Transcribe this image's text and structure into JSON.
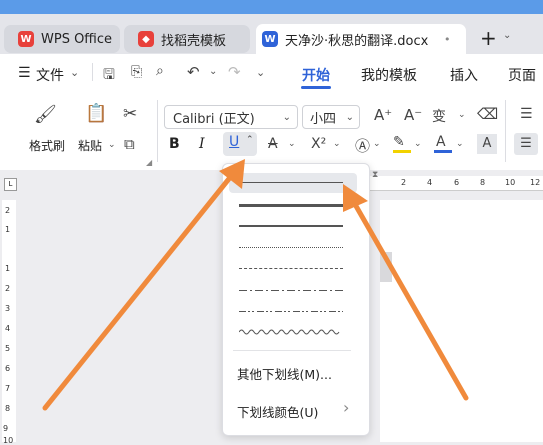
{
  "tabs": {
    "wps": {
      "label": "WPS Office",
      "icon": "wps-logo-icon",
      "color": "#e8413b"
    },
    "daoke": {
      "label": "找稻壳模板",
      "icon": "daoke-icon",
      "color": "#e8413b"
    },
    "doc": {
      "label": "天净沙·秋思的翻译.docx",
      "icon": "word-doc-icon",
      "color": "#2f63d8"
    },
    "new_tab": "+",
    "dot": "•"
  },
  "menu": {
    "file": "文件",
    "items": [
      "开始",
      "我的模板",
      "插入",
      "页面"
    ],
    "active_color": "#2f63d8"
  },
  "ribbon": {
    "format_painter": "格式刷",
    "paste": "粘贴",
    "font": "Calibri (正文)",
    "size": "小四",
    "bold": "B",
    "italic": "I",
    "underline": "U",
    "superscript": "X²",
    "pinyin": "A",
    "char_border": "A"
  },
  "ruler": {
    "h": [
      "2",
      "4",
      "6",
      "8",
      "10",
      "12"
    ],
    "v": [
      "2",
      "1",
      "1",
      "2",
      "3",
      "4",
      "5",
      "6",
      "7",
      "8",
      "9",
      "10"
    ]
  },
  "dropdown": {
    "more": "其他下划线(M)...",
    "color": "下划线颜色(U)",
    "arrow": "›"
  },
  "colors": {
    "arrow": "#f08a3c",
    "highlight": "#f2d200",
    "fontcolor": "#2f63d8"
  }
}
